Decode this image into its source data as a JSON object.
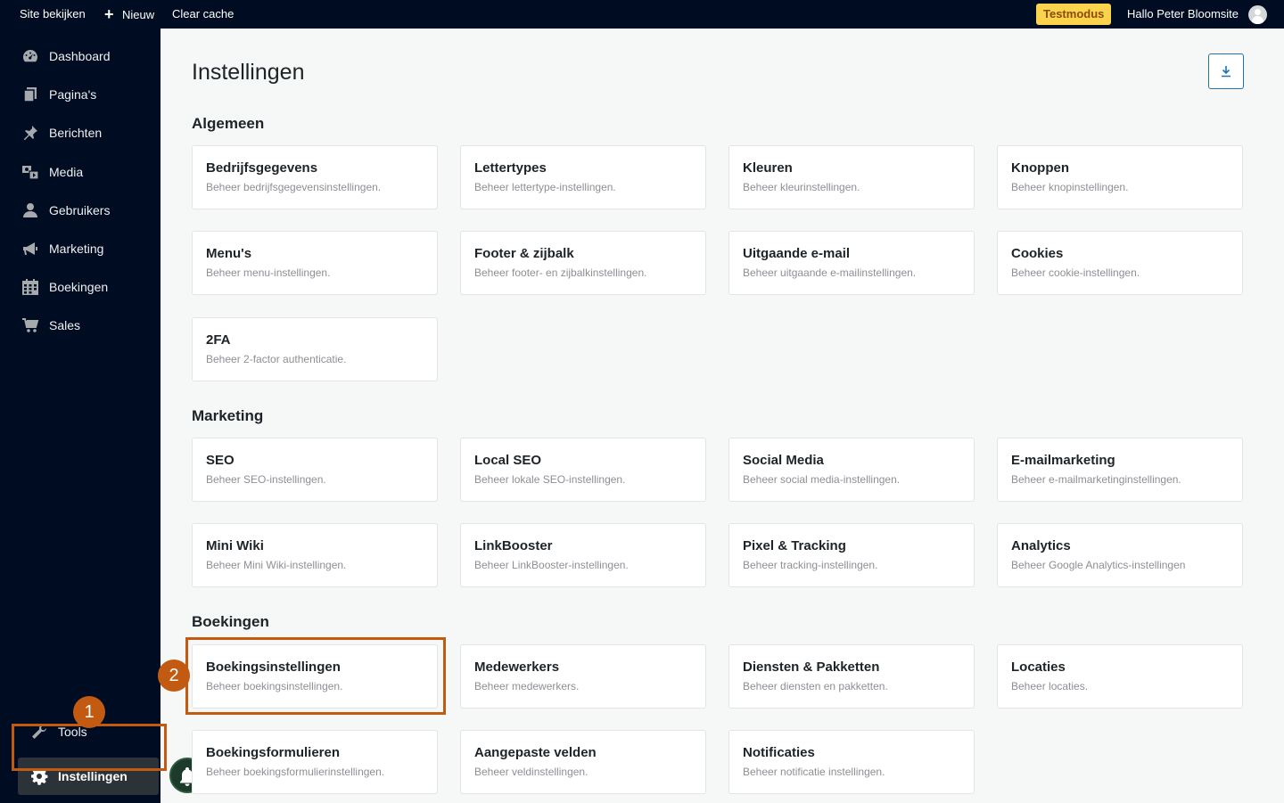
{
  "adminbar": {
    "site_label": "Site bekijken",
    "new_label": "Nieuw",
    "cache_label": "Clear cache",
    "testmodus_label": "Testmodus",
    "greeting": "Hallo Peter Bloomsite"
  },
  "sidebar": {
    "items": [
      {
        "label": "Dashboard",
        "icon": "dashboard-icon"
      },
      {
        "label": "Pagina's",
        "icon": "pages-icon"
      },
      {
        "label": "Berichten",
        "icon": "pin-icon"
      },
      {
        "label": "Media",
        "icon": "media-icon"
      },
      {
        "label": "Gebruikers",
        "icon": "user-icon"
      },
      {
        "label": "Marketing",
        "icon": "megaphone-icon"
      },
      {
        "label": "Boekingen",
        "icon": "calendar-icon"
      },
      {
        "label": "Sales",
        "icon": "cart-icon"
      }
    ],
    "tools_label": "Tools",
    "settings_label": "Instellingen"
  },
  "annotations": {
    "badge_1": "1",
    "badge_2": "2",
    "highlight_color": "#c25a12"
  },
  "main": {
    "title": "Instellingen",
    "sections": [
      {
        "title": "Algemeen",
        "cards": [
          {
            "title": "Bedrijfsgegevens",
            "desc": "Beheer bedrijfsgegevensinstellingen."
          },
          {
            "title": "Lettertypes",
            "desc": "Beheer lettertype-instellingen."
          },
          {
            "title": "Kleuren",
            "desc": "Beheer kleurinstellingen."
          },
          {
            "title": "Knoppen",
            "desc": "Beheer knopinstellingen."
          },
          {
            "title": "Menu's",
            "desc": "Beheer menu-instellingen."
          },
          {
            "title": "Footer & zijbalk",
            "desc": "Beheer footer- en zijbalkinstellingen."
          },
          {
            "title": "Uitgaande e-mail",
            "desc": "Beheer uitgaande e-mailinstellingen."
          },
          {
            "title": "Cookies",
            "desc": "Beheer cookie-instellingen."
          },
          {
            "title": "2FA",
            "desc": "Beheer 2-factor authenticatie."
          }
        ]
      },
      {
        "title": "Marketing",
        "cards": [
          {
            "title": "SEO",
            "desc": "Beheer SEO-instellingen."
          },
          {
            "title": "Local SEO",
            "desc": "Beheer lokale SEO-instellingen."
          },
          {
            "title": "Social Media",
            "desc": "Beheer social media-instellingen."
          },
          {
            "title": "E-mailmarketing",
            "desc": "Beheer e-mailmarketinginstellingen."
          },
          {
            "title": "Mini Wiki",
            "desc": "Beheer Mini Wiki-instellingen."
          },
          {
            "title": "LinkBooster",
            "desc": "Beheer LinkBooster-instellingen."
          },
          {
            "title": "Pixel & Tracking",
            "desc": "Beheer tracking-instellingen."
          },
          {
            "title": "Analytics",
            "desc": "Beheer Google Analytics-instellingen"
          }
        ]
      },
      {
        "title": "Boekingen",
        "cards": [
          {
            "title": "Boekingsinstellingen",
            "desc": "Beheer boekingsinstellingen."
          },
          {
            "title": "Medewerkers",
            "desc": "Beheer medewerkers."
          },
          {
            "title": "Diensten & Pakketten",
            "desc": "Beheer diensten en pakketten."
          },
          {
            "title": "Locaties",
            "desc": "Beheer locaties."
          },
          {
            "title": "Boekingsformulieren",
            "desc": "Beheer boekingsformulierinstellingen."
          },
          {
            "title": "Aangepaste velden",
            "desc": "Beheer veldinstellingen."
          },
          {
            "title": "Notificaties",
            "desc": "Beheer notificatie instellingen."
          }
        ]
      }
    ]
  }
}
